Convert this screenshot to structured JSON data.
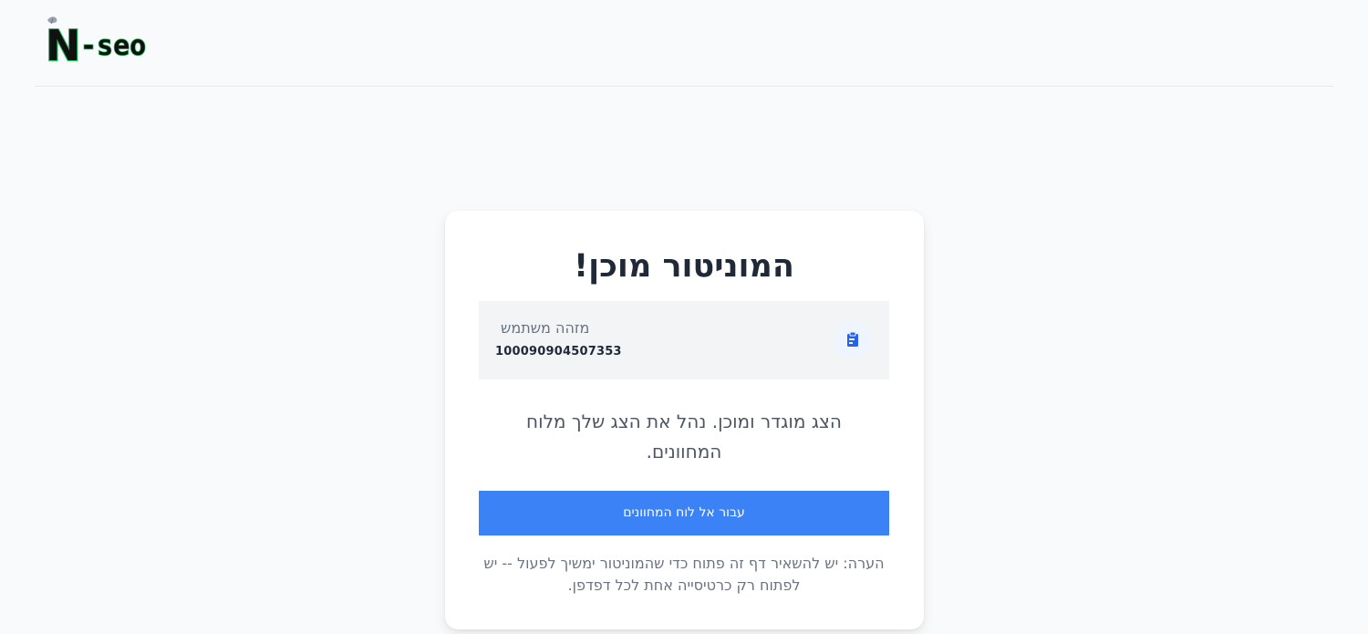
{
  "header": {
    "logo_text": "N-seo"
  },
  "card": {
    "title": "המוניטור מוכן!",
    "user_id_label": "מזהה משתמש",
    "user_id_value": "100090904507353",
    "copy_icon": "clipboard-icon",
    "message": "הצג מוגדר ומוכן. נהל את הצג שלך מלוח המחוונים.",
    "dashboard_button_label": "עבור אל לוח המחוונים",
    "note": "הערה: יש להשאיר דף זה פתוח כדי שהמוניטור ימשיך לפעול -- יש לפתוח רק כרטיסייה אחת לכל דפדפן."
  },
  "colors": {
    "accent": "#3b82f6",
    "background": "#f8fafc",
    "logo_green": "#22c55e"
  }
}
